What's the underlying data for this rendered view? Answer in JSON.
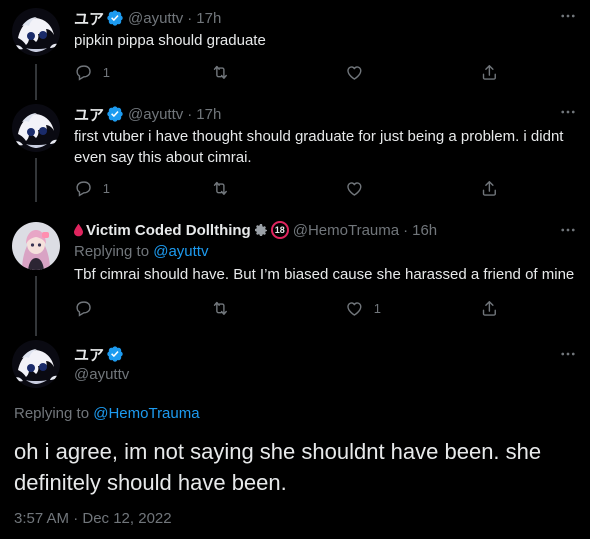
{
  "tweets": [
    {
      "display_name": "ユア",
      "handle": "@ayuttv",
      "separator": "·",
      "time": "17h",
      "text": "pipkin pippa should graduate",
      "reply_count": "1"
    },
    {
      "display_name": "ユア",
      "handle": "@ayuttv",
      "separator": "·",
      "time": "17h",
      "text": "first vtuber i have thought should graduate for just being a problem. i didnt even say this about cimrai.",
      "reply_count": "1"
    },
    {
      "display_name": "Victim Coded Dollthing",
      "handle": "@HemoTrauma",
      "separator": "·",
      "time": "16h",
      "replying_prefix": "Replying to",
      "replying_to": "@ayuttv",
      "age_badge": "18",
      "text": "Tbf cimrai should have. But I’m biased cause she harassed a friend of mine",
      "like_count": "1"
    }
  ],
  "main_tweet": {
    "display_name": "ユア",
    "handle": "@ayuttv",
    "replying_prefix": "Replying to",
    "replying_to": "@HemoTrauma",
    "text": "oh i agree, im not saying she shouldnt have been. she definitely should have been.",
    "timestamp": "3:57 AM · Dec 12, 2022"
  },
  "icons": [
    "more-icon",
    "reply-icon",
    "retweet-icon",
    "like-icon",
    "share-icon",
    "verified-badge-icon",
    "blood-drop-icon",
    "gear-icon"
  ],
  "colors": {
    "background": "#000000",
    "text": "#e7e9ea",
    "muted": "#71767b",
    "link": "#1d9bf0",
    "thread_line": "#333639",
    "drop": "#e0245e"
  }
}
